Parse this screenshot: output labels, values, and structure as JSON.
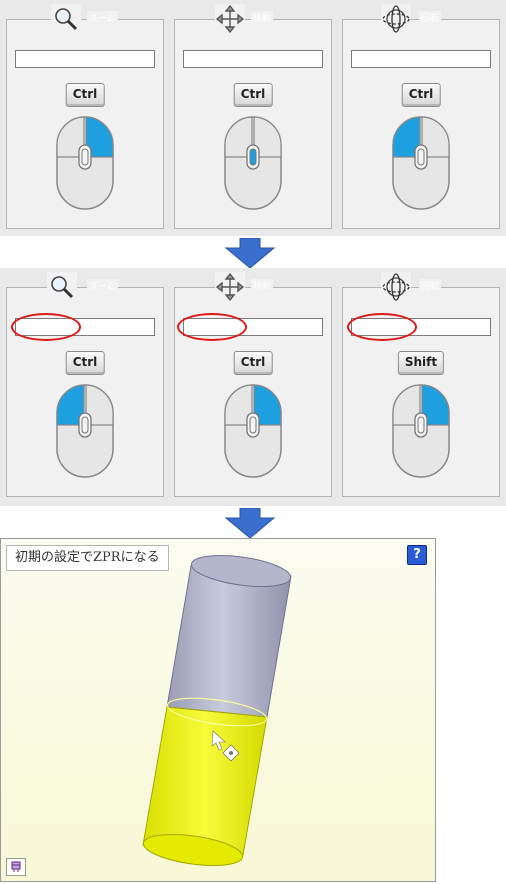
{
  "colors": {
    "accent": "#1ea0e0",
    "arrow": "#3a6fcf",
    "highlight_oval": "#e01818",
    "help_button": "#2a5bd7",
    "cylinder_top": "#b4b7cb",
    "cylinder_bottom": "#ecf200"
  },
  "before": {
    "zoom": {
      "legend": "ズーム",
      "icon": "zoom-icon",
      "key": "Ctrl",
      "mouse_highlight": "right-button"
    },
    "pan": {
      "legend": "移動",
      "icon": "pan-icon",
      "key": "Ctrl",
      "mouse_highlight": "wheel"
    },
    "rotate": {
      "legend": "回転",
      "icon": "rotate-icon",
      "key": "Ctrl",
      "mouse_highlight": "left-button"
    }
  },
  "after": {
    "zoom": {
      "legend": "ズーム",
      "icon": "zoom-icon",
      "key": "Ctrl",
      "mouse_highlight": "left-button"
    },
    "pan": {
      "legend": "移動",
      "icon": "pan-icon",
      "key": "Ctrl",
      "mouse_highlight": "right-button"
    },
    "rotate": {
      "legend": "回転",
      "icon": "rotate-icon",
      "key": "Shift",
      "mouse_highlight": "right-button"
    }
  },
  "viewer": {
    "title": "初期の設定でZPRになる",
    "help_label": "?",
    "help_icon": "help-icon",
    "corner_icon": "view-cube-icon"
  }
}
